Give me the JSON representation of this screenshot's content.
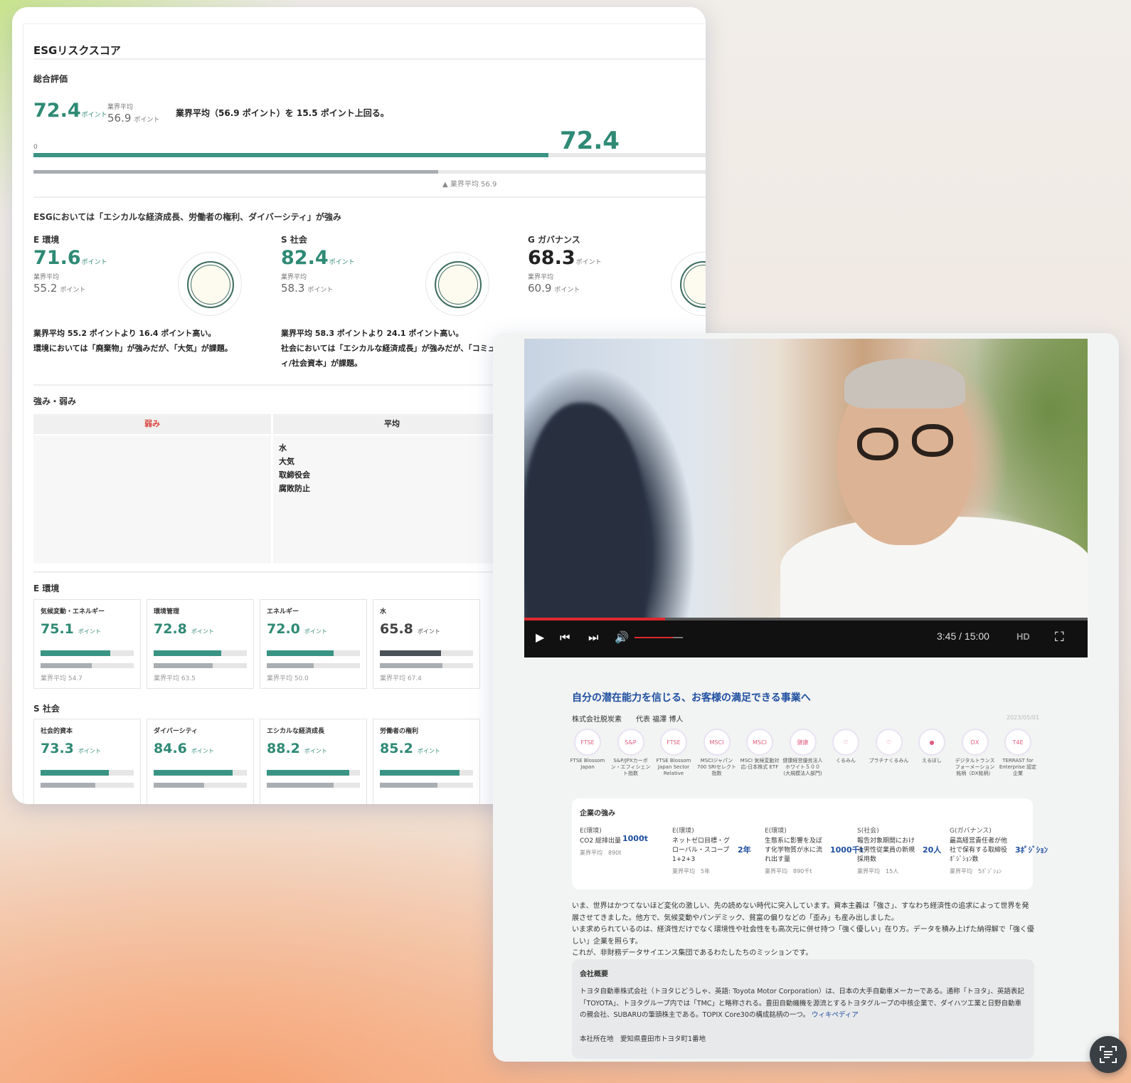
{
  "esg": {
    "title": "ESGリスクスコア",
    "overall": {
      "label": "総合評価",
      "score": "72.4",
      "unit": "ポイント",
      "avg_label": "業界平均",
      "avg_score": "56.9",
      "summary": "業界平均（56.9 ポイント）を 15.5 ポイント上回る。",
      "bar_zero": "0",
      "bar_value_label": "72.4",
      "bar_avg_label": "▲ 業界平均 56.9",
      "score_fraction": 0.724,
      "avg_fraction": 0.569
    },
    "headline": "ESGにおいては「エシカルな経済成長、労働者の権利、ダイバーシティ」が強み",
    "pillars": [
      {
        "label": "E 環境",
        "score": "71.6",
        "unit": "ポイント",
        "avg_label": "業界平均",
        "avg": "55.2",
        "avg_unit": "ポイント",
        "line1": "業界平均 55.2 ポイントより 16.4 ポイント高い。",
        "line2": "環境においては「廃棄物」が強みだが、「大気」が課題。"
      },
      {
        "label": "S 社会",
        "score": "82.4",
        "unit": "ポイント",
        "avg_label": "業界平均",
        "avg": "58.3",
        "avg_unit": "ポイント",
        "line1": "業界平均 58.3 ポイントより 24.1 ポイント高い。",
        "line2": "社会においては「エシカルな経済成長」が強みだが、「コミュニテ",
        "line3": "ィ/社会資本」が課題。"
      },
      {
        "label": "G ガバナンス",
        "score": "68.3",
        "unit": "ポイント",
        "avg_label": "業界平均",
        "avg": "60.9",
        "avg_unit": "ポイント"
      }
    ],
    "sw": {
      "label": "強み・弱み",
      "col_weak": "弱み",
      "col_avg": "平均",
      "avg_items": [
        "水",
        "大気",
        "取締役会",
        "腐敗防止"
      ]
    },
    "e_section": {
      "label": "E 環境",
      "metrics": [
        {
          "name": "気候変動・エネルギー",
          "value": "75.1",
          "unit": "ポイント",
          "avg": "業界平均 54.7",
          "fill": 0.751,
          "avg_fill": 0.547
        },
        {
          "name": "環境管理",
          "value": "72.8",
          "unit": "ポイント",
          "avg": "業界平均 63.5",
          "fill": 0.728,
          "avg_fill": 0.635
        },
        {
          "name": "エネルギー",
          "value": "72.0",
          "unit": "ポイント",
          "avg": "業界平均 50.0",
          "fill": 0.72,
          "avg_fill": 0.5
        },
        {
          "name": "水",
          "value": "65.8",
          "unit": "ポイント",
          "avg": "業界平均 67.4",
          "fill": 0.658,
          "avg_fill": 0.674
        }
      ]
    },
    "s_section": {
      "label": "S 社会",
      "metrics": [
        {
          "name": "社会的資本",
          "value": "73.3",
          "unit": "ポイント",
          "fill": 0.733,
          "avg_fill": 0.59
        },
        {
          "name": "ダイバーシティ",
          "value": "84.6",
          "unit": "ポイント",
          "fill": 0.846,
          "avg_fill": 0.54
        },
        {
          "name": "エシカルな経済成長",
          "value": "88.2",
          "unit": "ポイント",
          "fill": 0.882,
          "avg_fill": 0.72
        },
        {
          "name": "労働者の権利",
          "value": "85.2",
          "unit": "ポイント",
          "fill": 0.852,
          "avg_fill": 0.62
        }
      ]
    }
  },
  "video": {
    "time": "3:45 / 15:00",
    "hd": "HD",
    "progress": 0.25,
    "volume": 0.8
  },
  "article": {
    "title": "自分の潜在能力を信じる、お客様の満足できる事業へ",
    "company": "株式会社脱炭素　　代表  福澤 博人",
    "date": "2023/05/01",
    "badges": [
      {
        "icon": "FTSE",
        "label": "FTSE Blossom Japan"
      },
      {
        "icon": "S&P",
        "label": "S&P/JPXカーボン・エフィシェント指数"
      },
      {
        "icon": "FTSE",
        "label": "FTSE Blossom Japan Sector Relative"
      },
      {
        "icon": "MSCI",
        "label": "MSCIジャパン700 SRIセレクト指数"
      },
      {
        "icon": "MSCI",
        "label": "MSCI 気候変動対応-日本株式 ETF"
      },
      {
        "icon": "健康",
        "label": "健康経営優良法人ホワイト５００(大規模法人部門)"
      },
      {
        "icon": "♡",
        "label": "くるみん"
      },
      {
        "icon": "♡",
        "label": "プラチナくるみん"
      },
      {
        "icon": "●",
        "label": "えるぼし"
      },
      {
        "icon": "DX",
        "label": "デジタルトランスフォーメーション銘柄（DX銘柄）"
      },
      {
        "icon": "T4E",
        "label": "TERRAST for Enterprise 認定企業"
      }
    ],
    "strengths": {
      "title": "企業の強み",
      "items": [
        {
          "cat": "E(環境)",
          "name": "CO2 総排出量",
          "value": "1000t",
          "avg": "業界平均　890t"
        },
        {
          "cat": "E(環境)",
          "name": "ネットゼロ目標・グローバル・スコープ1+2+3",
          "value": "2年",
          "avg": "業界平均　5年"
        },
        {
          "cat": "E(環境)",
          "name": "生態系に影響を及ぼす化学物質が水に流れ出す量",
          "value": "1000千t",
          "avg": "業界平均　890千t"
        },
        {
          "cat": "S(社会)",
          "name": "報告対象期間における男性従業員の新規採用数",
          "value": "20人",
          "avg": "業界平均　15人"
        },
        {
          "cat": "G(ガバナンス)",
          "name": "最高経営責任者が他社で保有する取締役ﾎﾟｼﾞｼｮﾝ数",
          "value": "3ﾎﾟｼﾞｼｮﾝ",
          "avg": "業界平均　5ﾎﾟｼﾞｼｮﾝ"
        }
      ]
    },
    "body": [
      "いま、世界はかつてないほど変化の激しい、先の読めない時代に突入しています。資本主義は「強さ」、すなわち経済性の追求によって世界を発展させてきました。他方で、気候変動やパンデミック、貧富の偏りなどの「歪み」も産み出しました。",
      "いま求められているのは、経済性だけでなく環境性や社会性をも高次元に併せ持つ「強く優しい」在り方。データを積み上げた納得解で「強く優しい」企業を照らす。",
      "これが、非財務データサイエンス集団であるわたしたちのミッションです。"
    ],
    "overview": {
      "title": "会社概要",
      "text": "トヨタ自動車株式会社（トヨタじどうしゃ、英語: Toyota Motor Corporation）は、日本の大手自動車メーカーである。通称「トヨタ」、英語表記「TOYOTA」、トヨタグループ内では「TMC」と略称される。豊田自動織機を源流とするトヨタグループの中核企業で、ダイハツ工業と日野自動車の親会社、SUBARUの筆頭株主である。TOPIX Core30の構成銘柄の一つ。",
      "link": "ウィキペディア",
      "address": "本社所在地　愛知県豊田市トヨタ町1番地"
    }
  }
}
